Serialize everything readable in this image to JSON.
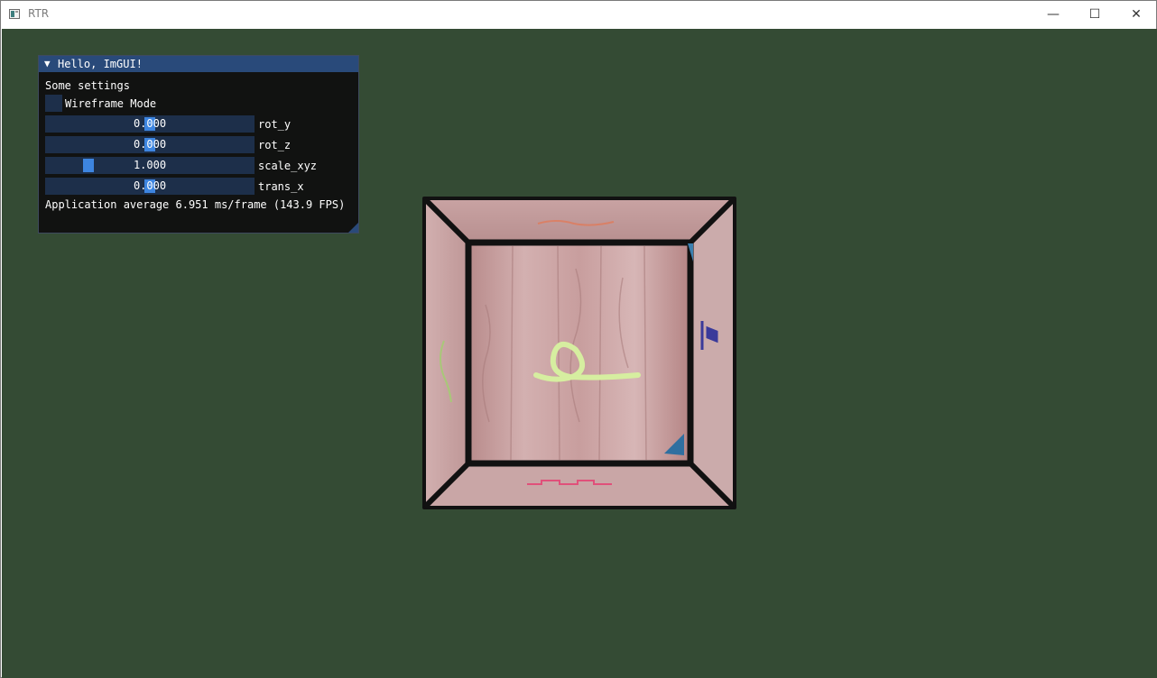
{
  "window": {
    "title": "RTR",
    "minimize_glyph": "—",
    "maximize_glyph": "☐",
    "close_glyph": "✕"
  },
  "imgui": {
    "title": "Hello, ImGUI!",
    "collapse_glyph": "▼",
    "settings_heading": "Some settings",
    "checkbox_label": "Wireframe Mode",
    "wireframe_checked": false,
    "sliders": [
      {
        "label": "rot_y",
        "value": "0.000"
      },
      {
        "label": "rot_z",
        "value": "0.000"
      },
      {
        "label": "scale_xyz",
        "value": "1.000"
      },
      {
        "label": "trans_x",
        "value": "0.000"
      }
    ],
    "stats": "Application average 6.951 ms/frame (143.9 FPS)"
  },
  "colors": {
    "clear_color": "#344b34",
    "imgui_title_bg": "#294a7a",
    "imgui_frame_bg": "#1d2f4a",
    "imgui_accent": "#3d85e0",
    "crate_wood": "#c7a0a0"
  }
}
